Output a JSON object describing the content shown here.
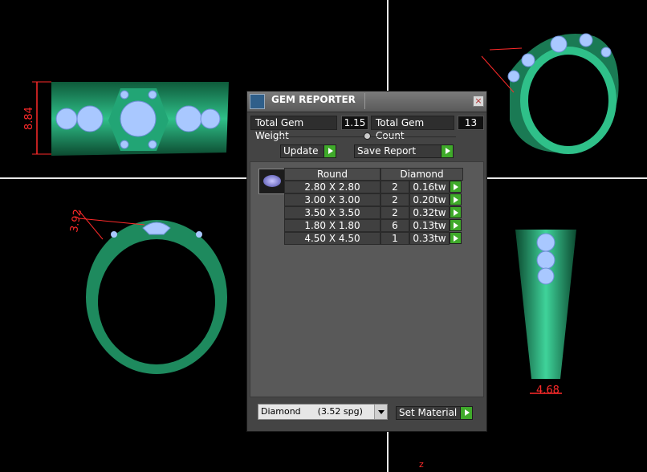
{
  "viewports": {
    "front_dimension": "8.84",
    "left_dimension": "3.92",
    "right_dimension": "4.68",
    "axis_label": "z"
  },
  "panel": {
    "title": "GEM REPORTER",
    "close_glyph": "×",
    "total_gem_weight_label": "Total Gem Weight",
    "total_gem_weight_value": "1.15",
    "total_gem_count_label": "Total Gem Count",
    "total_gem_count_value": "13",
    "update_label": "Update",
    "save_report_label": "Save Report",
    "table": {
      "shape_header": "Round",
      "material_header": "Diamond",
      "rows": [
        {
          "size": "2.80 X 2.80",
          "count": "2",
          "weight": "0.16tw"
        },
        {
          "size": "3.00 X 3.00",
          "count": "2",
          "weight": "0.20tw"
        },
        {
          "size": "3.50 X 3.50",
          "count": "2",
          "weight": "0.32tw"
        },
        {
          "size": "1.80 X 1.80",
          "count": "6",
          "weight": "0.13tw"
        },
        {
          "size": "4.50 X 4.50",
          "count": "1",
          "weight": "0.33tw"
        }
      ]
    },
    "material_select": "Diamond      (3.52 spg)",
    "set_material_label": "Set Material"
  },
  "colors": {
    "metal": "#1e8a5e",
    "gem": "#a9c8ff",
    "dimension": "#ff2a2a",
    "play_button": "#3faa2a"
  }
}
